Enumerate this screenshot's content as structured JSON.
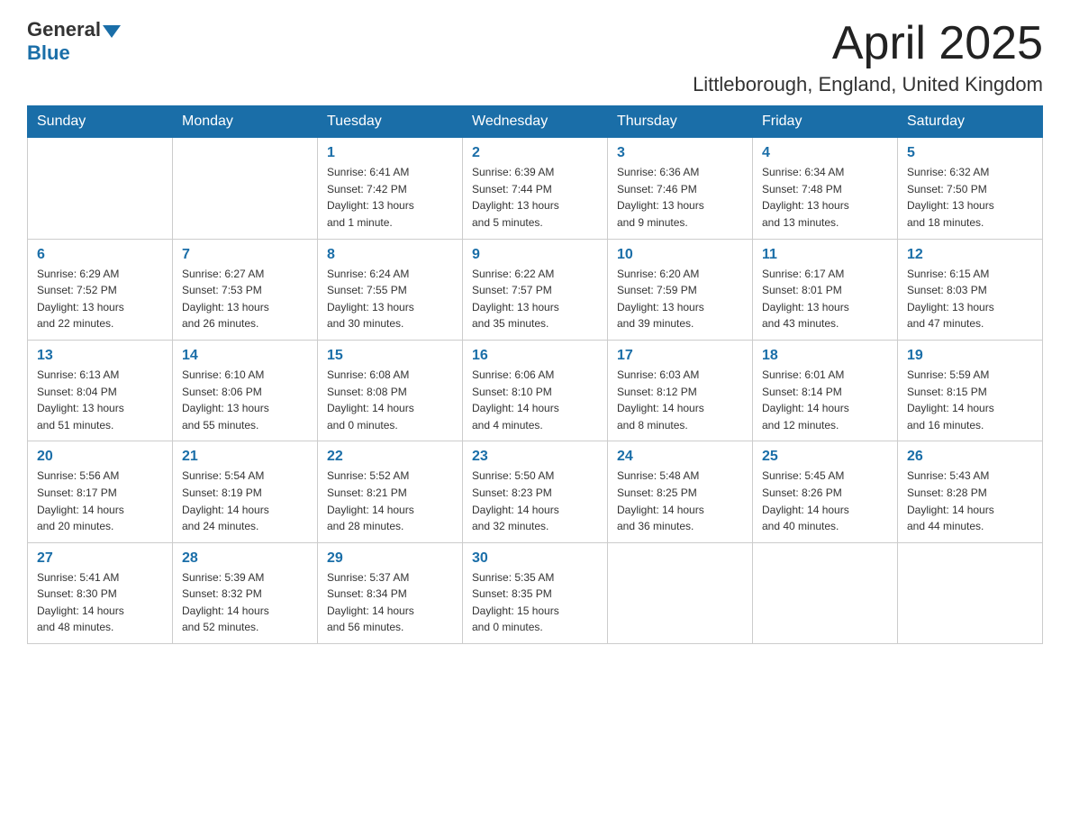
{
  "header": {
    "logo_general": "General",
    "logo_blue": "Blue",
    "month_title": "April 2025",
    "location": "Littleborough, England, United Kingdom"
  },
  "weekdays": [
    "Sunday",
    "Monday",
    "Tuesday",
    "Wednesday",
    "Thursday",
    "Friday",
    "Saturday"
  ],
  "weeks": [
    [
      {
        "day": "",
        "info": ""
      },
      {
        "day": "",
        "info": ""
      },
      {
        "day": "1",
        "info": "Sunrise: 6:41 AM\nSunset: 7:42 PM\nDaylight: 13 hours\nand 1 minute."
      },
      {
        "day": "2",
        "info": "Sunrise: 6:39 AM\nSunset: 7:44 PM\nDaylight: 13 hours\nand 5 minutes."
      },
      {
        "day": "3",
        "info": "Sunrise: 6:36 AM\nSunset: 7:46 PM\nDaylight: 13 hours\nand 9 minutes."
      },
      {
        "day": "4",
        "info": "Sunrise: 6:34 AM\nSunset: 7:48 PM\nDaylight: 13 hours\nand 13 minutes."
      },
      {
        "day": "5",
        "info": "Sunrise: 6:32 AM\nSunset: 7:50 PM\nDaylight: 13 hours\nand 18 minutes."
      }
    ],
    [
      {
        "day": "6",
        "info": "Sunrise: 6:29 AM\nSunset: 7:52 PM\nDaylight: 13 hours\nand 22 minutes."
      },
      {
        "day": "7",
        "info": "Sunrise: 6:27 AM\nSunset: 7:53 PM\nDaylight: 13 hours\nand 26 minutes."
      },
      {
        "day": "8",
        "info": "Sunrise: 6:24 AM\nSunset: 7:55 PM\nDaylight: 13 hours\nand 30 minutes."
      },
      {
        "day": "9",
        "info": "Sunrise: 6:22 AM\nSunset: 7:57 PM\nDaylight: 13 hours\nand 35 minutes."
      },
      {
        "day": "10",
        "info": "Sunrise: 6:20 AM\nSunset: 7:59 PM\nDaylight: 13 hours\nand 39 minutes."
      },
      {
        "day": "11",
        "info": "Sunrise: 6:17 AM\nSunset: 8:01 PM\nDaylight: 13 hours\nand 43 minutes."
      },
      {
        "day": "12",
        "info": "Sunrise: 6:15 AM\nSunset: 8:03 PM\nDaylight: 13 hours\nand 47 minutes."
      }
    ],
    [
      {
        "day": "13",
        "info": "Sunrise: 6:13 AM\nSunset: 8:04 PM\nDaylight: 13 hours\nand 51 minutes."
      },
      {
        "day": "14",
        "info": "Sunrise: 6:10 AM\nSunset: 8:06 PM\nDaylight: 13 hours\nand 55 minutes."
      },
      {
        "day": "15",
        "info": "Sunrise: 6:08 AM\nSunset: 8:08 PM\nDaylight: 14 hours\nand 0 minutes."
      },
      {
        "day": "16",
        "info": "Sunrise: 6:06 AM\nSunset: 8:10 PM\nDaylight: 14 hours\nand 4 minutes."
      },
      {
        "day": "17",
        "info": "Sunrise: 6:03 AM\nSunset: 8:12 PM\nDaylight: 14 hours\nand 8 minutes."
      },
      {
        "day": "18",
        "info": "Sunrise: 6:01 AM\nSunset: 8:14 PM\nDaylight: 14 hours\nand 12 minutes."
      },
      {
        "day": "19",
        "info": "Sunrise: 5:59 AM\nSunset: 8:15 PM\nDaylight: 14 hours\nand 16 minutes."
      }
    ],
    [
      {
        "day": "20",
        "info": "Sunrise: 5:56 AM\nSunset: 8:17 PM\nDaylight: 14 hours\nand 20 minutes."
      },
      {
        "day": "21",
        "info": "Sunrise: 5:54 AM\nSunset: 8:19 PM\nDaylight: 14 hours\nand 24 minutes."
      },
      {
        "day": "22",
        "info": "Sunrise: 5:52 AM\nSunset: 8:21 PM\nDaylight: 14 hours\nand 28 minutes."
      },
      {
        "day": "23",
        "info": "Sunrise: 5:50 AM\nSunset: 8:23 PM\nDaylight: 14 hours\nand 32 minutes."
      },
      {
        "day": "24",
        "info": "Sunrise: 5:48 AM\nSunset: 8:25 PM\nDaylight: 14 hours\nand 36 minutes."
      },
      {
        "day": "25",
        "info": "Sunrise: 5:45 AM\nSunset: 8:26 PM\nDaylight: 14 hours\nand 40 minutes."
      },
      {
        "day": "26",
        "info": "Sunrise: 5:43 AM\nSunset: 8:28 PM\nDaylight: 14 hours\nand 44 minutes."
      }
    ],
    [
      {
        "day": "27",
        "info": "Sunrise: 5:41 AM\nSunset: 8:30 PM\nDaylight: 14 hours\nand 48 minutes."
      },
      {
        "day": "28",
        "info": "Sunrise: 5:39 AM\nSunset: 8:32 PM\nDaylight: 14 hours\nand 52 minutes."
      },
      {
        "day": "29",
        "info": "Sunrise: 5:37 AM\nSunset: 8:34 PM\nDaylight: 14 hours\nand 56 minutes."
      },
      {
        "day": "30",
        "info": "Sunrise: 5:35 AM\nSunset: 8:35 PM\nDaylight: 15 hours\nand 0 minutes."
      },
      {
        "day": "",
        "info": ""
      },
      {
        "day": "",
        "info": ""
      },
      {
        "day": "",
        "info": ""
      }
    ]
  ]
}
